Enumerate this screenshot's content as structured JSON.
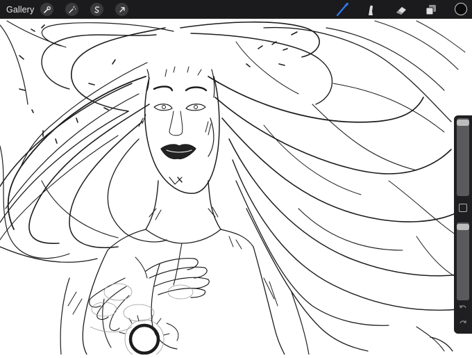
{
  "toolbar": {
    "gallery_label": "Gallery",
    "left_tools": [
      "wrench-icon",
      "magic-wand-icon",
      "selection-icon",
      "transform-arrow-icon"
    ],
    "right_tools": [
      "brush-icon",
      "smudge-icon",
      "eraser-icon",
      "layers-icon"
    ],
    "active_tool": "brush-icon",
    "active_color": "#0b0b0b",
    "accent_color": "#2f7bf5"
  },
  "sidebar": {
    "brush_size_level": 0.0,
    "opacity_level": 0.0,
    "modify_button": "square-icon",
    "undo": "undo-icon",
    "redo": "redo-icon"
  }
}
